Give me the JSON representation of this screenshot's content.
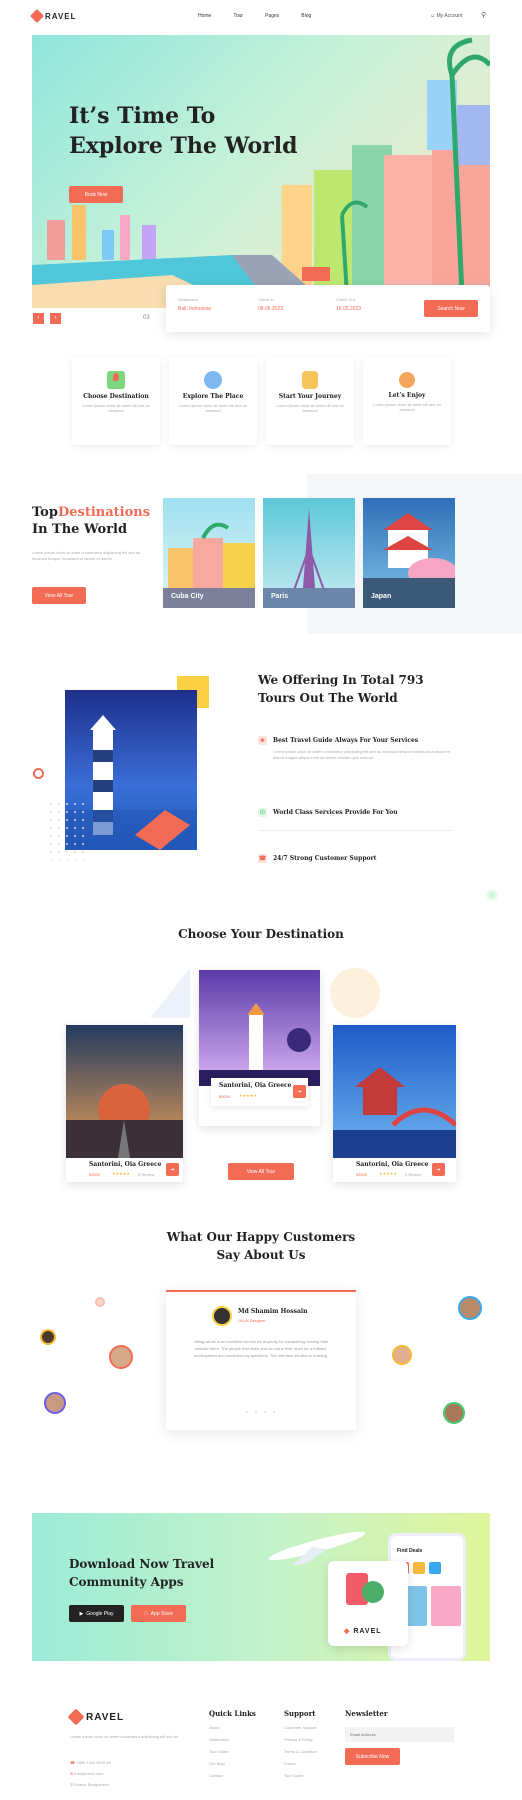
{
  "brand": {
    "logo_text": "RAVEL",
    "accent": "#f26b55"
  },
  "nav": {
    "items": [
      "Home",
      "Tour",
      "Pages",
      "Blog"
    ],
    "account": "My Account"
  },
  "hero": {
    "title_line1": "It’s Time To",
    "title_line2": "Explore The World",
    "cta": "Book Now",
    "slide_counter": "03",
    "search": {
      "fields": [
        {
          "label": "Destination",
          "value": "Bali, Indonesia"
        },
        {
          "label": "Check In",
          "value": "08.05.2023"
        },
        {
          "label": "Check Out",
          "value": "15.05.2023"
        }
      ],
      "button": "Search Now"
    }
  },
  "features": [
    {
      "title": "Choose Destination",
      "text": "Lorem ipsum dolor sit amet elit sed do eiusmod"
    },
    {
      "title": "Explore The Place",
      "text": "Lorem ipsum dolor sit amet elit sed do eiusmod"
    },
    {
      "title": "Start Your Journey",
      "text": "Lorem ipsum dolor sit amet elit sed do eiusmod"
    },
    {
      "title": "Let’s Enjoy",
      "text": "Lorem ipsum dolor sit amet elit sed do eiusmod"
    }
  ],
  "top_dest": {
    "title_a": "Top",
    "title_b": "Destinations",
    "title_c": "In The World",
    "text": "Lorem ipsum dolor sit amet consectetur adipiscing elit sed do eiusmod tempor incididunt ut labore et dolore",
    "button": "View All Tour",
    "cards": [
      "Cuba City",
      "Paris",
      "Japan"
    ]
  },
  "offer": {
    "title_line1": "We Offering In Total 793",
    "title_line2": "Tours Out The World",
    "items": [
      {
        "title": "Best Travel Guide Always For Your Services",
        "text": "Lorem ipsum dolor sit amet consectetur adipiscing elit sed do eiusmod tempor incididunt ut labore et dolore magna aliqua enim ad minim veniam quis nostrud"
      },
      {
        "title": "World Class Services Provide For You",
        "text": ""
      },
      {
        "title": "24/7 Strong Customer Support",
        "text": ""
      }
    ]
  },
  "choose": {
    "title": "Choose Your Destination",
    "button": "View All Tour",
    "cards": [
      {
        "name": "Santorini, Oia Greece",
        "price": "$3000",
        "reviews": "5 Review"
      },
      {
        "name": "Santorini, Oia Greece",
        "price": "$3000",
        "reviews": "5 Review"
      },
      {
        "name": "Santorini, Oia Greece",
        "price": "$3000",
        "reviews": "5 Review"
      }
    ]
  },
  "testimonial": {
    "title_line1": "What Our Happy Customers",
    "title_line2": "Say About Us",
    "name": "Md Shamim Hossain",
    "role": "UI/UX Designer",
    "text": "Jetlag winds is an excellent service for anybody for considering hosting their website there. The people that listen and we value their more for a brilliant, development and resolution my questions. The interface intuitive in building."
  },
  "app": {
    "title_line1": "Download Now Travel",
    "title_line2": "Community Apps",
    "google": "Google Play",
    "apple": "App Store",
    "phone_title": "Find Deals",
    "phone_brand": "RAVEL"
  },
  "footer": {
    "about": "Lorem ipsum dolor sit amet consectetur adipiscing elit sed do",
    "phone": "+880 1234 5678 90",
    "email": "info@travel.com",
    "address": "Dhaka, Bangladesh",
    "quick_title": "Quick Links",
    "quick": [
      "About",
      "Destination",
      "Tour Guide",
      "Our Blog",
      "Contact"
    ],
    "support_title": "Support",
    "support": [
      "Customer Support",
      "Privacy & Policy",
      "Terms & Condition",
      "Forum",
      "Tour Guide"
    ],
    "news_title": "Newsletter",
    "news_placeholder": "Email Address",
    "news_button": "Subscribe Now"
  }
}
